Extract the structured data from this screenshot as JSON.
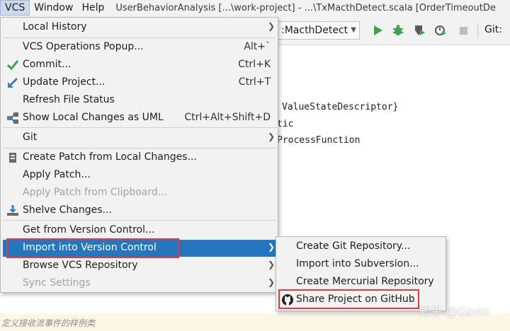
{
  "menubar": {
    "vcs": "VCS",
    "window": "Window",
    "help": "Help",
    "window_title": "UserBehaviorAnalysis [...\\work-project] - ...\\TxMacthDetect.scala [OrderTimeoutDe"
  },
  "toolbar": {
    "run_config": ":MacthDetect",
    "git": "Git:",
    "icons": [
      "run-icon",
      "debug-icon",
      "coverage-icon",
      "profile-icon",
      "stop-icon"
    ]
  },
  "editor": {
    "lines": [
      "ValueStateDescriptor}",
      "tic",
      "ProcessFunction"
    ]
  },
  "vcs_menu": {
    "items": [
      {
        "label": "Local History",
        "submenu": true
      },
      {
        "label": "VCS Operations Popup...",
        "shortcut": "Alt+`"
      },
      {
        "label": "Commit...",
        "shortcut": "Ctrl+K",
        "icon": "checkmark-icon"
      },
      {
        "label": "Update Project...",
        "shortcut": "Ctrl+T",
        "icon": "update-arrow-icon"
      },
      {
        "label": "Refresh File Status"
      },
      {
        "label": "Show Local Changes as UML",
        "shortcut": "Ctrl+Alt+Shift+D",
        "icon": "uml-icon"
      },
      {
        "label": "Git",
        "submenu": true
      },
      {
        "label": "Create Patch from Local Changes...",
        "icon": "patch-icon"
      },
      {
        "label": "Apply Patch..."
      },
      {
        "label": "Apply Patch from Clipboard...",
        "disabled": true
      },
      {
        "label": "Shelve Changes...",
        "icon": "shelve-icon"
      },
      {
        "label": "Get from Version Control..."
      },
      {
        "label": "Import into Version Control",
        "submenu": true,
        "selected": true
      },
      {
        "label": "Browse VCS Repository",
        "submenu": true
      },
      {
        "label": "Sync Settings",
        "submenu": true,
        "disabled": true
      }
    ]
  },
  "import_submenu": {
    "items": [
      {
        "label": "Create Git Repository..."
      },
      {
        "label": "Import into Subversion..."
      },
      {
        "label": "Create Mercurial Repository"
      },
      {
        "label": "Share Project on GitHub",
        "icon": "github-icon"
      }
    ]
  },
  "comment_text": "定义接收流事件的样例类",
  "watermark": "知乎 @Gavin",
  "colors": {
    "selection": "#2675bf",
    "highlight_box": "#e33b3b",
    "menu_bg": "#f2f2f2"
  }
}
